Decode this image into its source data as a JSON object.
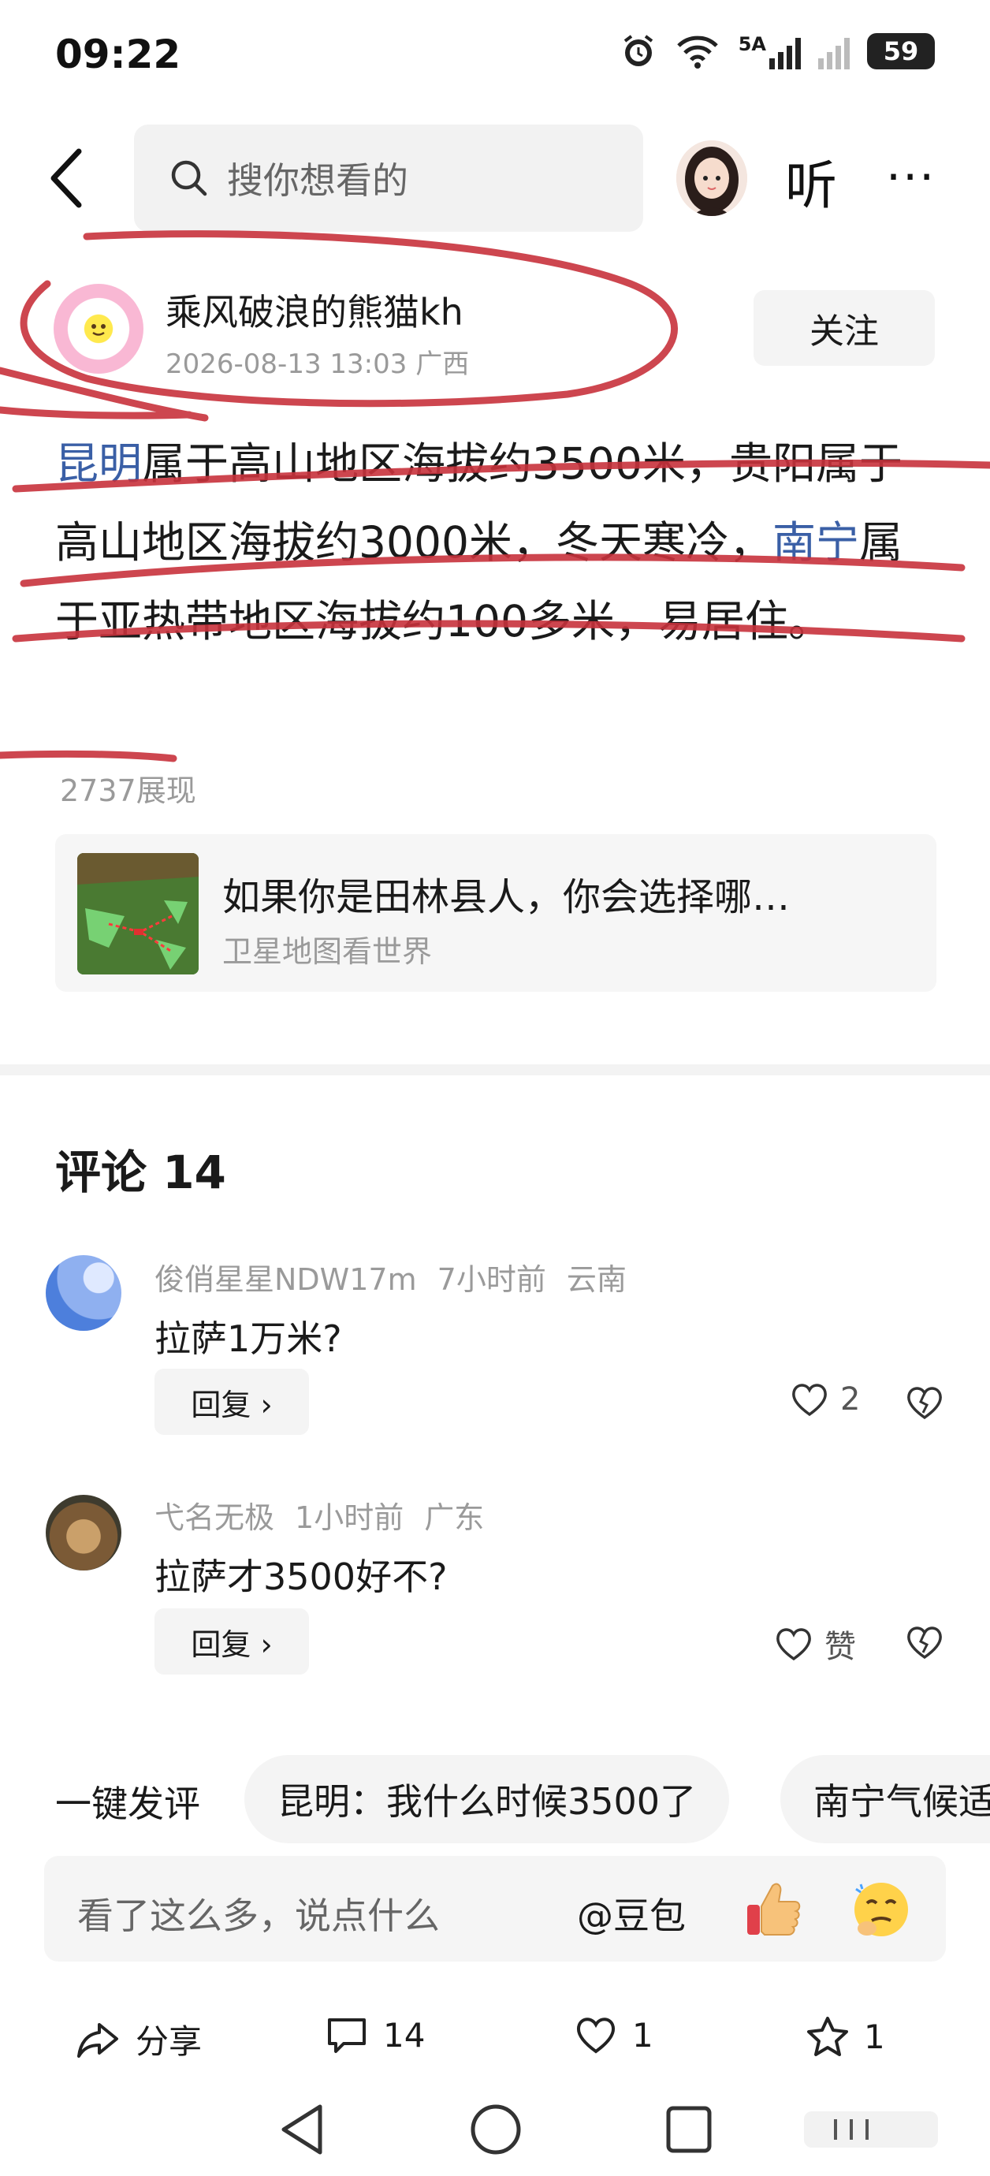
{
  "status_bar": {
    "time": "09:22",
    "network": "5A",
    "battery": "59"
  },
  "header": {
    "search_placeholder": "搜你想看的",
    "listen_label": "听",
    "more_label": "···"
  },
  "post": {
    "author": "乘风破浪的熊猫kh",
    "meta": "2026-08-13 13:03 广西",
    "follow_label": "关注",
    "body_parts": {
      "link1": "昆明",
      "text1": "属于高山地区海拔约3500米，贵阳属于高山地区海拔约3000米，冬天寒冷，",
      "link2": "南宁",
      "text2": "属于亚热带地区海拔约100多米，易居住。"
    },
    "views": "2737展现",
    "linked_card": {
      "title": "如果你是田林县人，你会选择哪…",
      "source": "卫星地图看世界"
    }
  },
  "comments": {
    "title": "评论 14",
    "items": [
      {
        "user": "俊俏星星NDW17m",
        "time": "7小时前",
        "region": "云南",
        "text": "拉萨1万米?",
        "reply_label": "回复 ›",
        "likes": "2"
      },
      {
        "user": "弋名无极",
        "time": "1小时前",
        "region": "广东",
        "text": "拉萨才3500好不?",
        "reply_label": "回复 ›",
        "likes": "赞"
      }
    ]
  },
  "quick_comment": {
    "label": "一键发评",
    "chips": [
      "昆明：我什么时候3500了",
      "南宁气候适"
    ]
  },
  "input": {
    "placeholder": "看了这么多，说点什么",
    "mention": "@豆包"
  },
  "actions": {
    "share": "分享",
    "comments": "14",
    "likes": "1",
    "favorites": "1"
  },
  "colors": {
    "link": "#3a5fa6",
    "annotation_red": "#c8323c",
    "meta_gray": "#9a9a9a"
  }
}
